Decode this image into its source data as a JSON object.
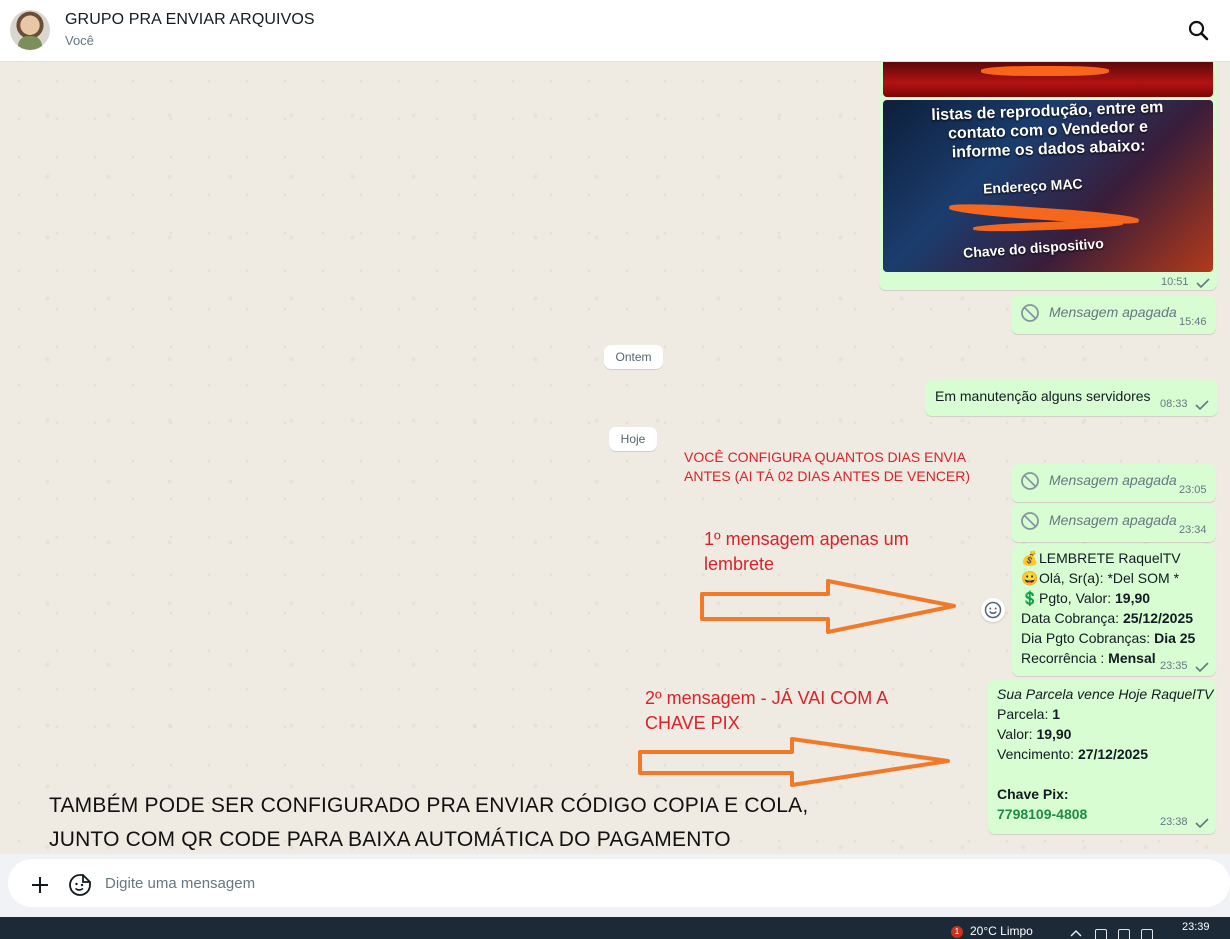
{
  "header": {
    "title": "GRUPO PRA ENVIAR ARQUIVOS",
    "subtitle": "Você",
    "icons": {
      "search": "search-icon"
    }
  },
  "messages": {
    "image_message": {
      "image_caption_lines": [
        "listas de reprodução, entre em",
        "contato com o Vendedor e",
        "informe os dados abaixo:"
      ],
      "mac_label": "Endereço MAC",
      "device_key_label": "Chave do dispositivo",
      "time": "10:51"
    },
    "deleted_1": {
      "text": "Mensagem apagada",
      "time": "15:46"
    },
    "date_yesterday": "Ontem",
    "maintenance": {
      "text": "Em manutenção alguns servidores",
      "time": "08:33"
    },
    "date_today": "Hoje",
    "deleted_2": {
      "text": "Mensagem apagada",
      "time": "23:05"
    },
    "deleted_3": {
      "text": "Mensagem apagada",
      "time": "23:34"
    },
    "reminder": {
      "line1": "LEMBRETE RaquelTV",
      "line2": "Olá, Sr(a): *Del SOM *",
      "line3_label": "Pgto, Valor: ",
      "line3_value": "19,90",
      "line4_label": "Data Cobrança: ",
      "line4_value": "25/12/2025",
      "line5_label": "Dia Pgto Cobranças: ",
      "line5_value": "Dia 25",
      "line6_label": "Recorrência : ",
      "line6_value": "Mensal",
      "time": "23:35"
    },
    "due_today": {
      "title": "Sua Parcela vence Hoje RaquelTV",
      "parcela_label": "Parcela: ",
      "parcela_value": "1",
      "valor_label": "Valor: ",
      "valor_value": "19,90",
      "venc_label": "Vencimento: ",
      "venc_value": "27/12/2025",
      "pix_label": "Chave Pix:",
      "pix_value": "7798109-4808",
      "time": "23:38"
    }
  },
  "annotations": {
    "config_note": [
      "VOCÊ CONFIGURA QUANTOS DIAS ENVIA",
      "ANTES (AI TÁ 02 DIAS ANTES DE VENCER)"
    ],
    "first_msg": [
      "1º mensagem apenas um",
      "lembrete"
    ],
    "second_msg": [
      "2º mensagem - JÁ VAI COM A",
      "CHAVE PIX"
    ],
    "bottom_note": [
      "TAMBÉM PODE SER CONFIGURADO PRA ENVIAR CÓDIGO COPIA E COLA,",
      "JUNTO COM QR CODE PARA BAIXA AUTOMÁTICA DO PAGAMENTO"
    ]
  },
  "composer": {
    "placeholder": "Digite uma mensagem"
  },
  "taskbar": {
    "weather": "20°C  Limpo",
    "notification_count": "1",
    "clock": "23:39"
  },
  "colors": {
    "outgoing_bubble": "#d9fdd3",
    "annotation_red": "#d8232a",
    "arrow_orange": "#f07a2a",
    "pix_green": "#1f8c45"
  }
}
